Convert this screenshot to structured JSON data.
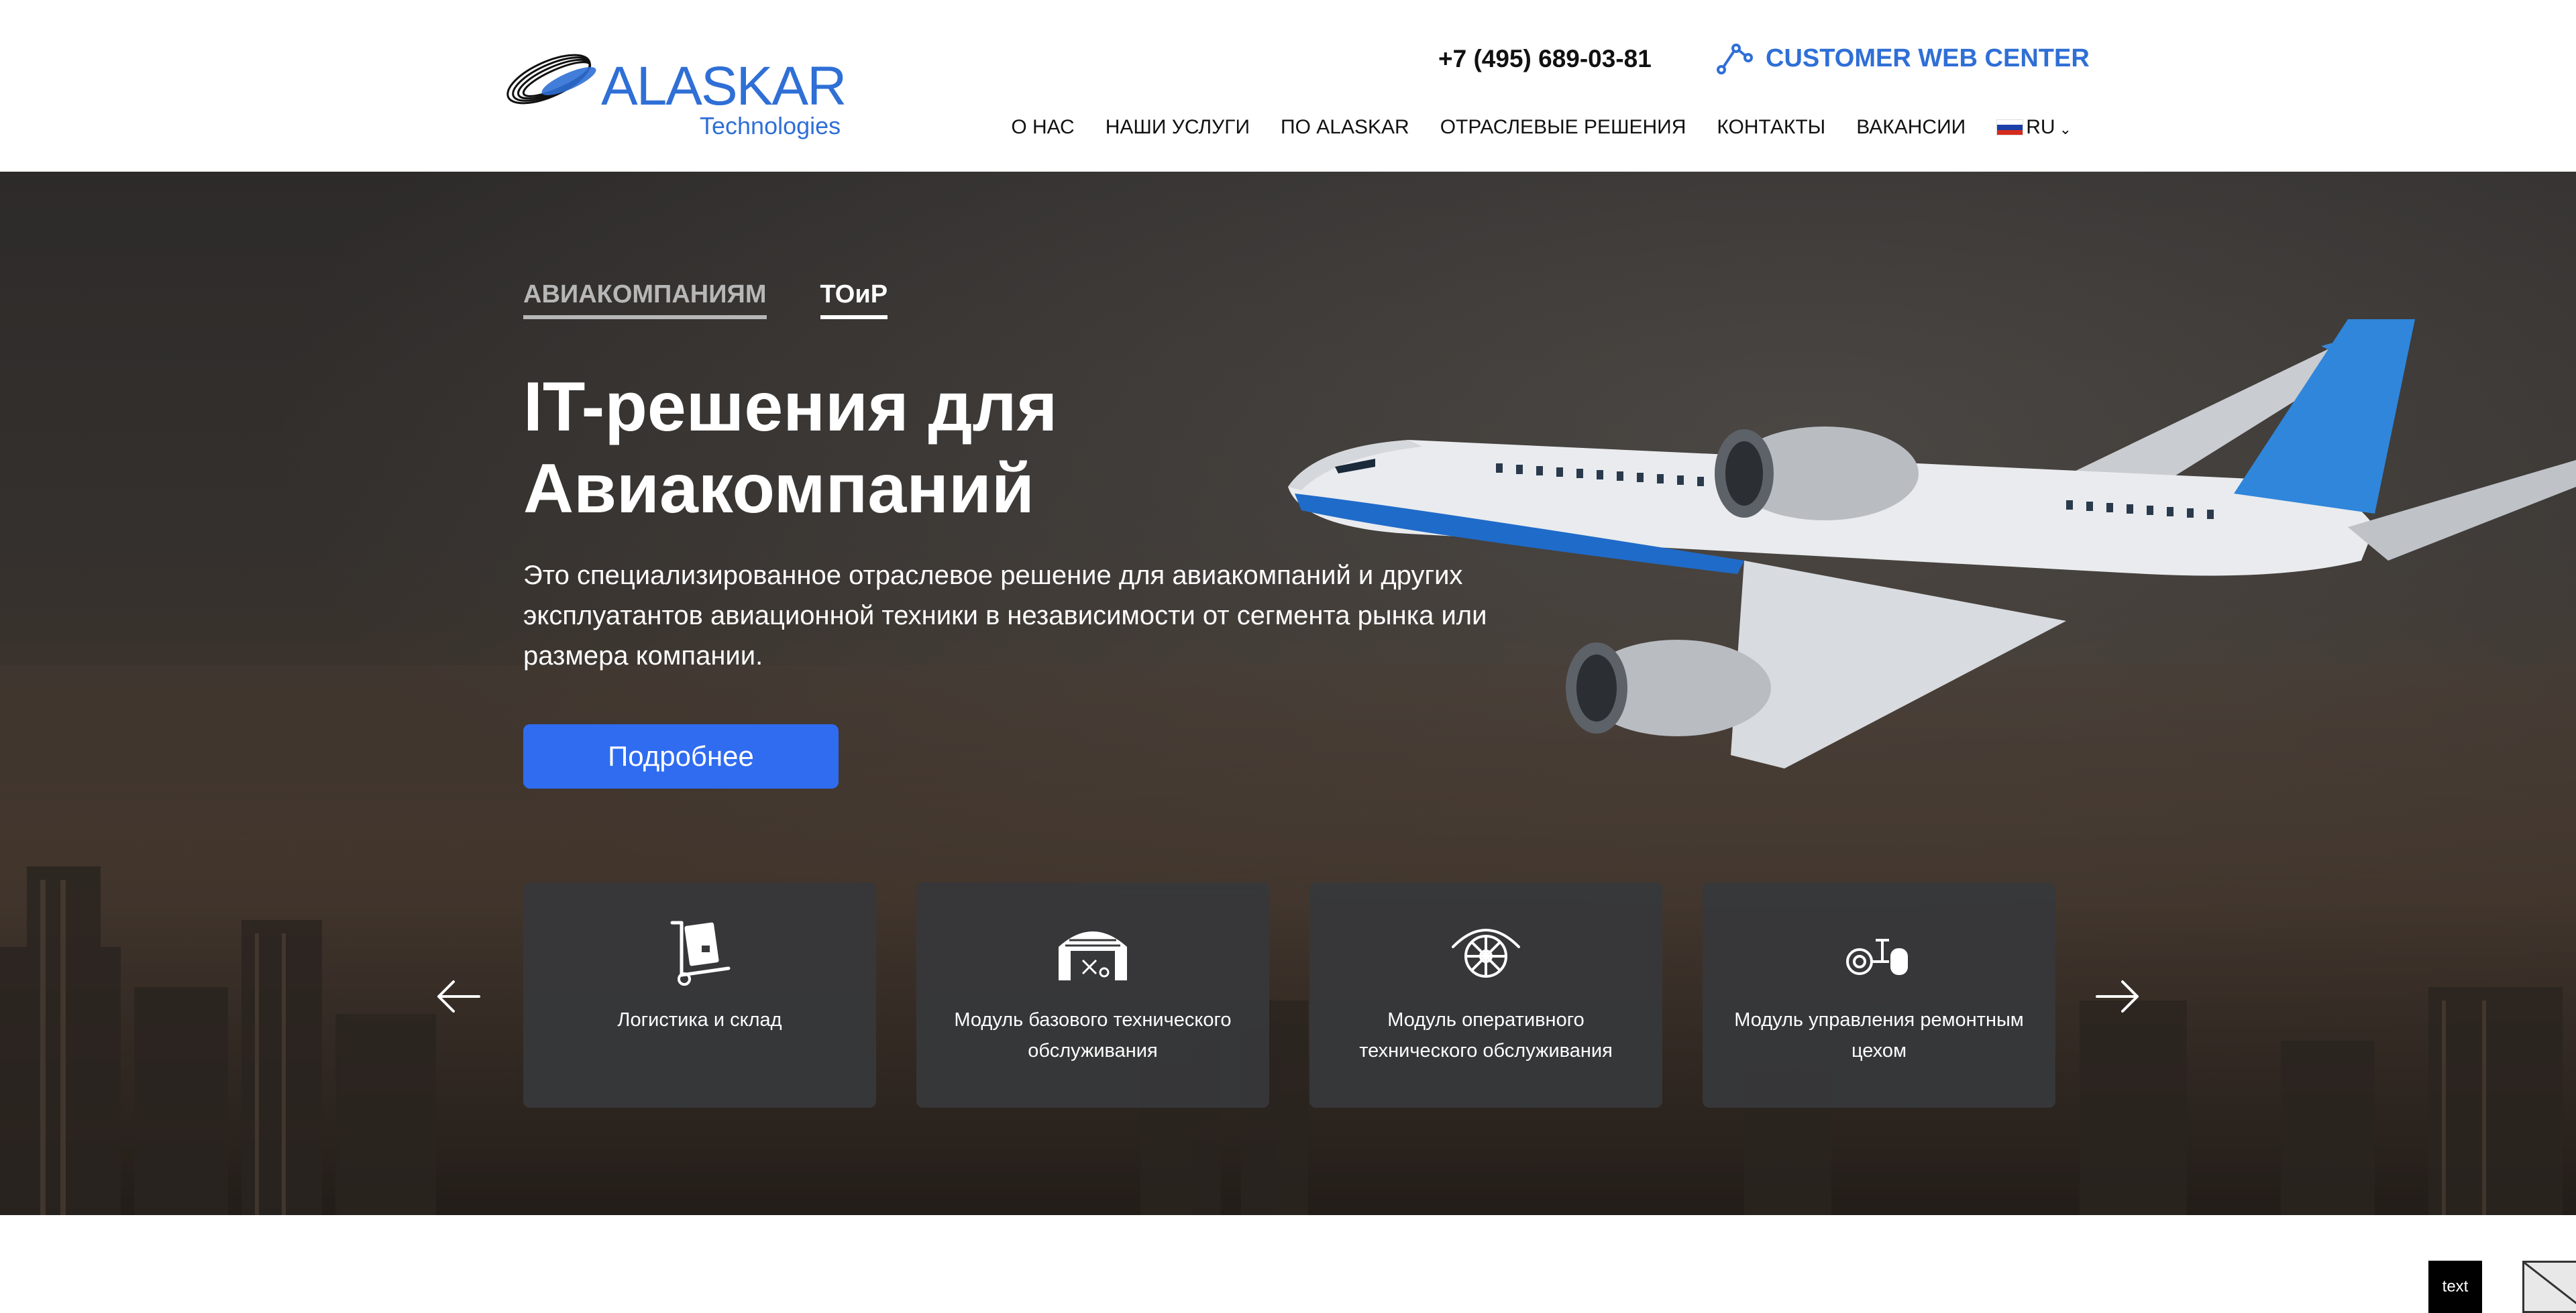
{
  "header": {
    "logo": {
      "name": "ALASKAR",
      "subtitle": "Technologies"
    },
    "phone": "+7 (495) 689-03-81",
    "customer_center": {
      "label": "CUSTOMER WEB CENTER",
      "icon": "network-nodes-icon"
    },
    "nav": [
      "О НАС",
      "НАШИ УСЛУГИ",
      "ПО ALASKAR",
      "ОТРАСЛЕВЫЕ РЕШЕНИЯ",
      "КОНТАКТЫ",
      "ВАКАНСИИ"
    ],
    "language": {
      "label": "RU",
      "flag": "russia-flag-icon"
    }
  },
  "hero": {
    "tabs": [
      {
        "label": "АВИАКОМПАНИЯМ",
        "active": false
      },
      {
        "label": "ТОиР",
        "active": true
      }
    ],
    "title_line1": "IT-решения для",
    "title_line2": "Авиакомпаний",
    "description": "Это специализированное отраслевое решение для авиакомпаний и других эксплуатантов авиационной техники в независимости от сегмента рынка или размера компании.",
    "cta_label": "Подробнее",
    "cards": [
      {
        "label": "Логистика и склад",
        "icon": "hand-truck-box-icon"
      },
      {
        "label": "Модуль базового технического обслуживания",
        "icon": "hangar-icon"
      },
      {
        "label": "Модуль оперативного технического обслуживания",
        "icon": "engine-inspection-icon"
      },
      {
        "label": "Модуль управления ремонтным цехом",
        "icon": "wheel-repair-icon"
      }
    ]
  },
  "footer_badge": "text",
  "colors": {
    "brand_blue": "#2f6fd6",
    "cta_blue": "#2f6cf0",
    "card_bg": "#37383a"
  }
}
